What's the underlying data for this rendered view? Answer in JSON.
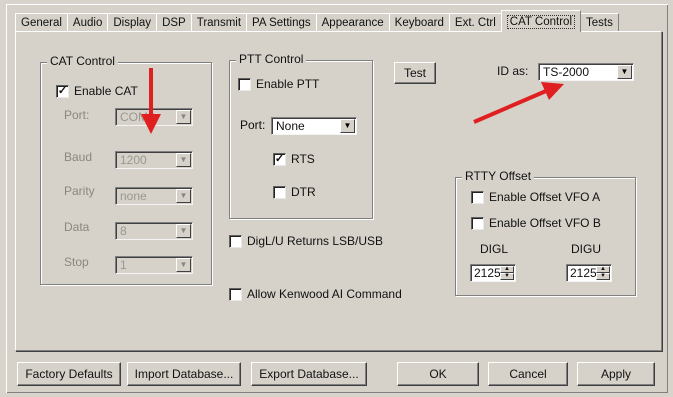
{
  "tabs": [
    {
      "label": "General"
    },
    {
      "label": "Audio"
    },
    {
      "label": "Display"
    },
    {
      "label": "DSP"
    },
    {
      "label": "Transmit"
    },
    {
      "label": "PA Settings"
    },
    {
      "label": "Appearance"
    },
    {
      "label": "Keyboard"
    },
    {
      "label": "Ext. Ctrl"
    },
    {
      "label": "CAT Control"
    },
    {
      "label": "Tests"
    }
  ],
  "active_tab": "CAT Control",
  "cat_control": {
    "title": "CAT Control",
    "enable_label": "Enable CAT",
    "enable_checked": true,
    "port_label": "Port:",
    "port_value": "COM3",
    "baud_label": "Baud",
    "baud_value": "1200",
    "parity_label": "Parity",
    "parity_value": "none",
    "data_label": "Data",
    "data_value": "8",
    "stop_label": "Stop",
    "stop_value": "1"
  },
  "ptt_control": {
    "title": "PTT Control",
    "enable_label": "Enable PTT",
    "enable_checked": false,
    "port_label": "Port:",
    "port_value": "None",
    "rts_label": "RTS",
    "rts_checked": true,
    "dtr_label": "DTR",
    "dtr_checked": false
  },
  "digl_label": "DigL/U Returns LSB/USB",
  "kenwood_label": "Allow Kenwood AI Command",
  "test_button": "Test",
  "id_as": {
    "label": "ID as:",
    "value": "TS-2000"
  },
  "rtty_offset": {
    "title": "RTTY Offset",
    "vfoa_label": "Enable Offset VFO A",
    "vfob_label": "Enable Offset VFO B",
    "digl_label": "DIGL",
    "digu_label": "DIGU",
    "digl_value": "2125",
    "digu_value": "2125"
  },
  "buttons": {
    "factory": "Factory Defaults",
    "import": "Import Database...",
    "export": "Export Database...",
    "ok": "OK",
    "cancel": "Cancel",
    "apply": "Apply"
  },
  "colors": {
    "annotation_arrow": "#e02020",
    "window_bg": "#d6d2ca"
  }
}
